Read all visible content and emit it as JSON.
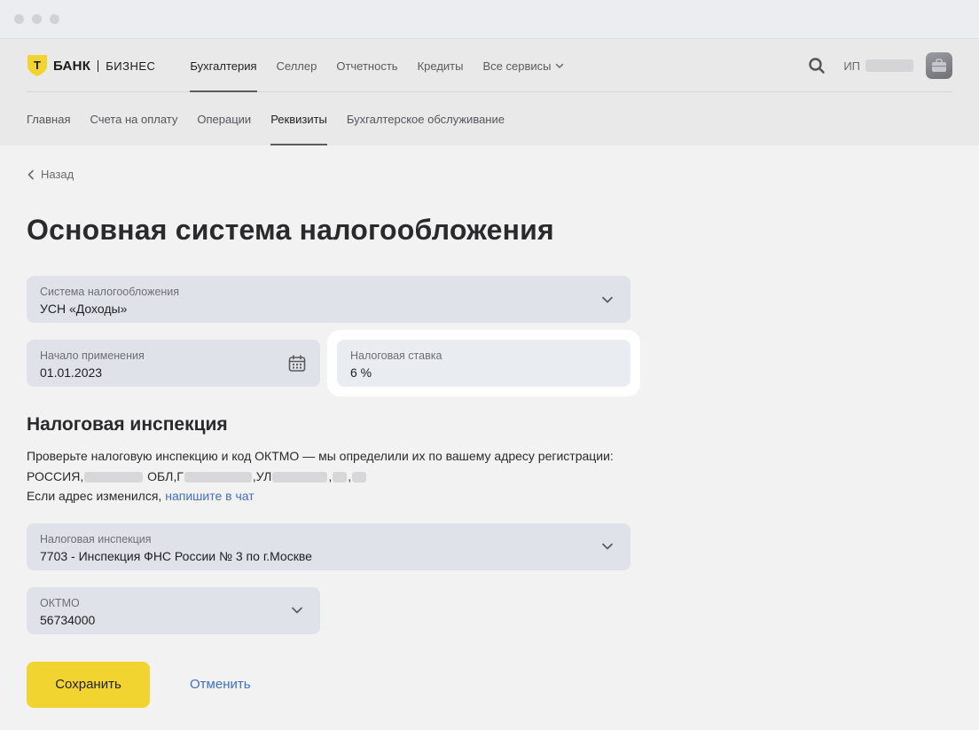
{
  "brand": {
    "logo_letter": "Т",
    "name": "БАНК",
    "sub": "БИЗНЕС",
    "color": "#f2d430"
  },
  "header": {
    "nav": [
      {
        "label": "Бухгалтерия",
        "active": true
      },
      {
        "label": "Селлер",
        "active": false
      },
      {
        "label": "Отчетность",
        "active": false
      },
      {
        "label": "Кредиты",
        "active": false
      },
      {
        "label": "Все сервисы",
        "active": false
      }
    ],
    "user_prefix": "ИП",
    "search_icon": "search-icon"
  },
  "subnav": [
    {
      "label": "Главная",
      "active": false
    },
    {
      "label": "Счета на оплату",
      "active": false
    },
    {
      "label": "Операции",
      "active": false
    },
    {
      "label": "Реквизиты",
      "active": true
    },
    {
      "label": "Бухгалтерское обслуживание",
      "active": false
    }
  ],
  "back_label": "Назад",
  "page_title": "Основная система налогообложения",
  "form": {
    "tax_system": {
      "label": "Система налогообложения",
      "value": "УСН «Доходы»"
    },
    "start_date": {
      "label": "Начало применения",
      "value": "01.01.2023"
    },
    "tax_rate": {
      "label": "Налоговая ставка",
      "value": "6 %"
    }
  },
  "inspection": {
    "title": "Налоговая инспекция",
    "text1": "Проверьте налоговую инспекцию и код ОКТМО — мы определили их по вашему адресу регистрации:",
    "addr_country": "РОССИЯ,",
    "addr_obl": "ОБЛ,Г",
    "addr_ul": ",УЛ",
    "text2": "Если адрес изменился,",
    "link": "напишите в чат",
    "field": {
      "label": "Налоговая инспекция",
      "value": "7703 - Инспекция ФНС России № 3 по г.Москве"
    },
    "oktmo": {
      "label": "ОКТМО",
      "value": "56734000"
    }
  },
  "actions": {
    "save": "Сохранить",
    "cancel": "Отменить"
  }
}
